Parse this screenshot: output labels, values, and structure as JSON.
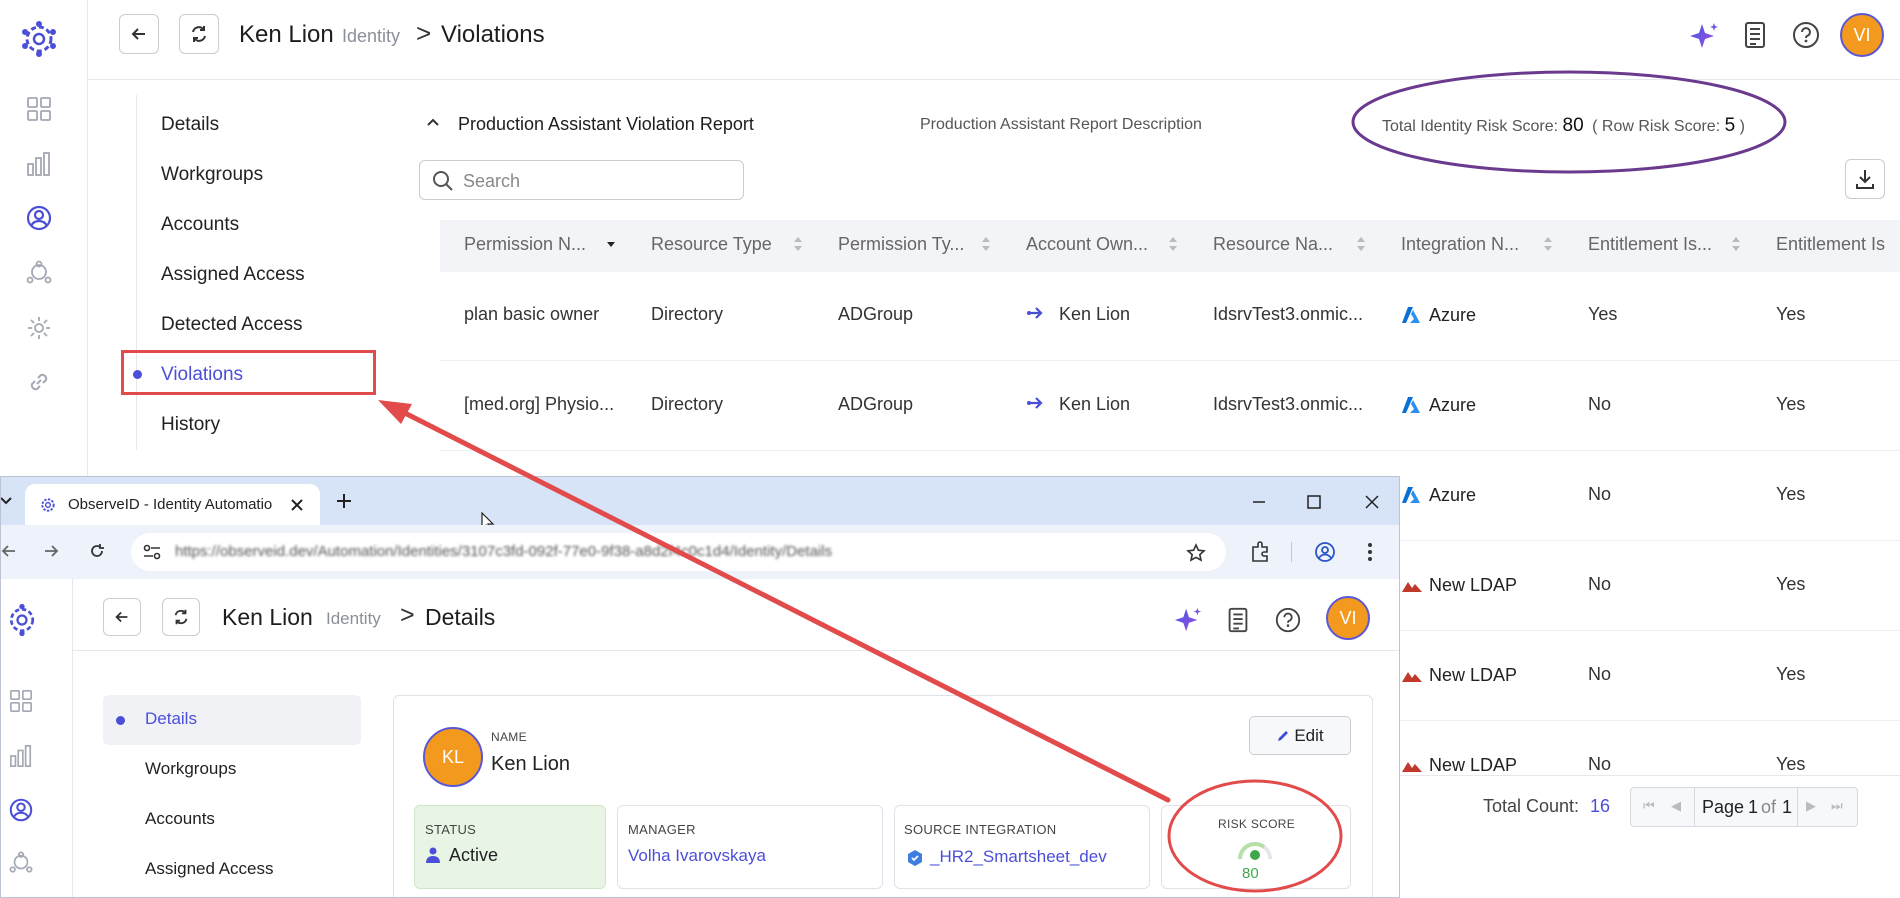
{
  "rail": {
    "icons": [
      "logo-icon",
      "dashboard-icon",
      "analytics-icon",
      "identity-icon",
      "integrations-icon",
      "settings-icon",
      "link-icon"
    ]
  },
  "header": {
    "name": "Ken Lion",
    "type": "Identity",
    "separator": ">",
    "page": "Violations",
    "avatar": "VI"
  },
  "sidenav": {
    "items": [
      "Details",
      "Workgroups",
      "Accounts",
      "Assigned Access",
      "Detected Access",
      "Violations",
      "History"
    ],
    "active": "Violations"
  },
  "report": {
    "title": "Production Assistant Violation Report",
    "description": "Production Assistant Report Description",
    "total_label": "Total Identity Risk Score:",
    "total_value": "80",
    "row_label": "( Row Risk Score:",
    "row_value": "5",
    "row_close": ")",
    "search_placeholder": "Search",
    "columns": [
      "Permission N...",
      "Resource Type",
      "Permission Ty...",
      "Account Own...",
      "Resource Na...",
      "Integration N...",
      "Entitlement Is...",
      "Entitlement Is"
    ],
    "rows": [
      {
        "permission": "plan basic owner",
        "resource_type": "Directory",
        "permission_type": "ADGroup",
        "owner": "Ken Lion",
        "resource_name": "IdsrvTest3.onmic...",
        "integration": "Azure",
        "ent1": "Yes",
        "ent2": "Yes"
      },
      {
        "permission": "[med.org] Physio...",
        "resource_type": "Directory",
        "permission_type": "ADGroup",
        "owner": "Ken Lion",
        "resource_name": "IdsrvTest3.onmic...",
        "integration": "Azure",
        "ent1": "No",
        "ent2": "Yes"
      },
      {
        "permission": "",
        "resource_type": "",
        "permission_type": "",
        "owner": "",
        "resource_name": "",
        "integration": "Azure",
        "ent1": "No",
        "ent2": "Yes"
      },
      {
        "permission": "",
        "resource_type": "",
        "permission_type": "",
        "owner": "",
        "resource_name": "",
        "integration": "New LDAP",
        "ent1": "No",
        "ent2": "Yes"
      },
      {
        "permission": "",
        "resource_type": "",
        "permission_type": "",
        "owner": "",
        "resource_name": "",
        "integration": "New LDAP",
        "ent1": "No",
        "ent2": "Yes"
      },
      {
        "permission": "",
        "resource_type": "",
        "permission_type": "",
        "owner": "",
        "resource_name": "",
        "integration": "New LDAP",
        "ent1": "No",
        "ent2": "Yes"
      }
    ],
    "total_count_label": "Total Count:",
    "total_count": "16",
    "page_label": "Page",
    "page_current": "1",
    "page_of": "of",
    "page_total": "1"
  },
  "popup": {
    "tab_title": "ObserveID - Identity Automatio",
    "url": "https://observeid.dev/Automation/Identities/3107c3fd-092f-77e0-9f38-a8d2f4c0c1d4/Identity/Details",
    "header": {
      "name": "Ken Lion",
      "type": "Identity",
      "separator": ">",
      "page": "Details",
      "avatar": "VI"
    },
    "nav": [
      "Details",
      "Workgroups",
      "Accounts",
      "Assigned Access"
    ],
    "active": "Details",
    "profile": {
      "initials": "KL",
      "name_caption": "NAME",
      "name": "Ken Lion",
      "edit_label": "Edit",
      "status_caption": "STATUS",
      "status": "Active",
      "manager_caption": "MANAGER",
      "manager": "Volha Ivarovskaya",
      "source_caption": "SOURCE INTEGRATION",
      "source": "_HR2_Smartsheet_dev",
      "risk_caption": "RISK SCORE",
      "risk": "80"
    }
  },
  "colors": {
    "accent": "#4b4fd8",
    "annotation_red": "#e24b4b",
    "annotation_purple": "#6a3a8e",
    "avatar_orange": "#f39a1e"
  }
}
